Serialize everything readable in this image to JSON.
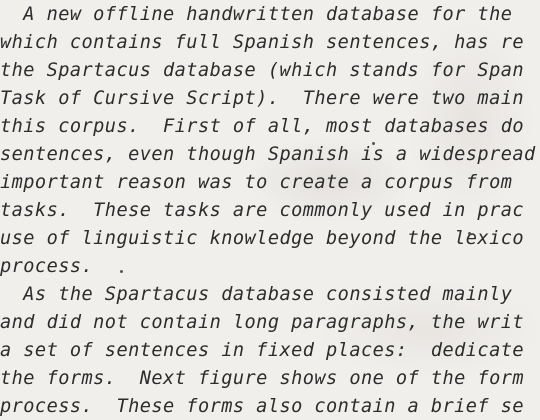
{
  "document": {
    "lines": [
      "  A new offline handwritten database for the",
      "which contains full Spanish sentences, has re",
      "the Spartacus database (which stands for Span",
      "Task of Cursive Script).  There were two main",
      "this corpus.  First of all, most databases do",
      "sentences, even though Spanish is a widespread",
      "important reason was to create a corpus from",
      "tasks.  These tasks are commonly used in prac",
      "use of linguistic knowledge beyond the lexico",
      "process.",
      "  As the Spartacus database consisted mainly",
      "and did not contain long paragraphs, the writ",
      "a set of sentences in fixed places:  dedicate",
      "the forms.  Next figure shows one of the form",
      "process.  These forms also contain a brief se"
    ]
  }
}
